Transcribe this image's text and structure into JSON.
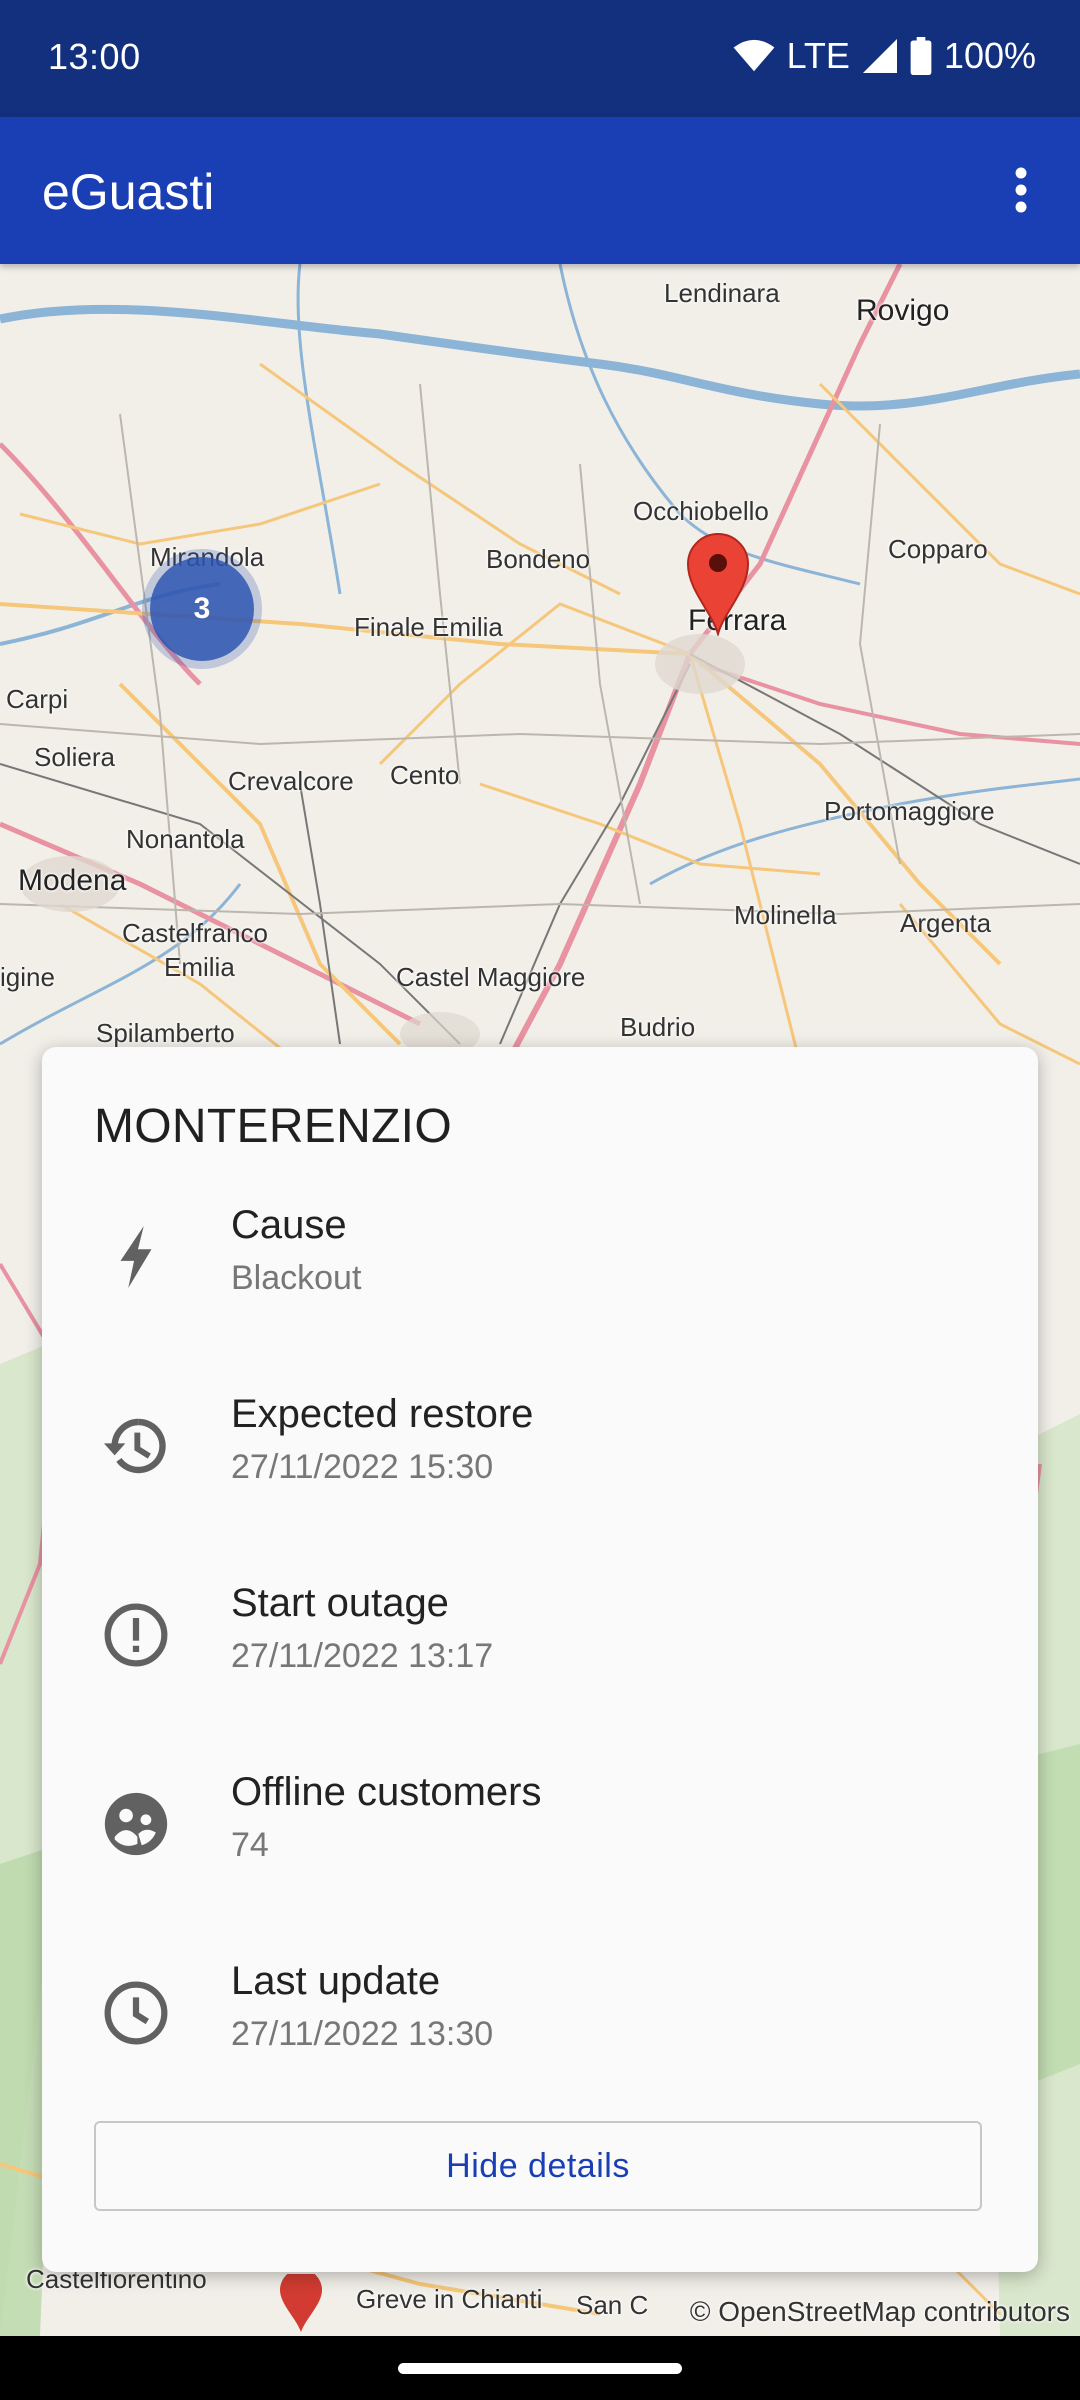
{
  "status_bar": {
    "time": "13:00",
    "network": "LTE",
    "battery": "100%"
  },
  "app_bar": {
    "title": "eGuasti",
    "menu_icon": "more-vert-icon"
  },
  "map": {
    "labels": {
      "lendinara": "Lendinara",
      "rovigo": "Rovigo",
      "occhiobello": "Occhiobello",
      "mirandola": "Mirandola",
      "bondeno": "Bondeno",
      "copparo": "Copparo",
      "ferrara": "Ferrara",
      "finale_emilia": "Finale Emilia",
      "carpi": "Carpi",
      "soliera": "Soliera",
      "crevalcore": "Crevalcore",
      "cento": "Cento",
      "portomaggiore": "Portomaggiore",
      "nonantola": "Nonantola",
      "modena": "Modena",
      "molinella": "Molinella",
      "argenta": "Argenta",
      "castelfranco": "Castelfranco",
      "emilia": "Emilia",
      "igine": "igine",
      "castel_maggiore": "Castel Maggiore",
      "spilamberto": "Spilamberto",
      "budrio": "Budrio",
      "greve": "Greve in Chianti",
      "san_c": "San C",
      "castelfiorentino": "Castelfiorentino"
    },
    "cluster_count": "3",
    "attribution": "© OpenStreetMap contributors"
  },
  "details": {
    "title": "MONTERENZIO",
    "rows": [
      {
        "icon": "bolt-icon",
        "label": "Cause",
        "value": "Blackout"
      },
      {
        "icon": "history-icon",
        "label": "Expected restore",
        "value": "27/11/2022 15:30"
      },
      {
        "icon": "error-outline-icon",
        "label": "Start outage",
        "value": "27/11/2022 13:17"
      },
      {
        "icon": "people-icon",
        "label": "Offline customers",
        "value": "74"
      },
      {
        "icon": "clock-icon",
        "label": "Last update",
        "value": "27/11/2022 13:30"
      }
    ],
    "hide_button": "Hide details"
  }
}
